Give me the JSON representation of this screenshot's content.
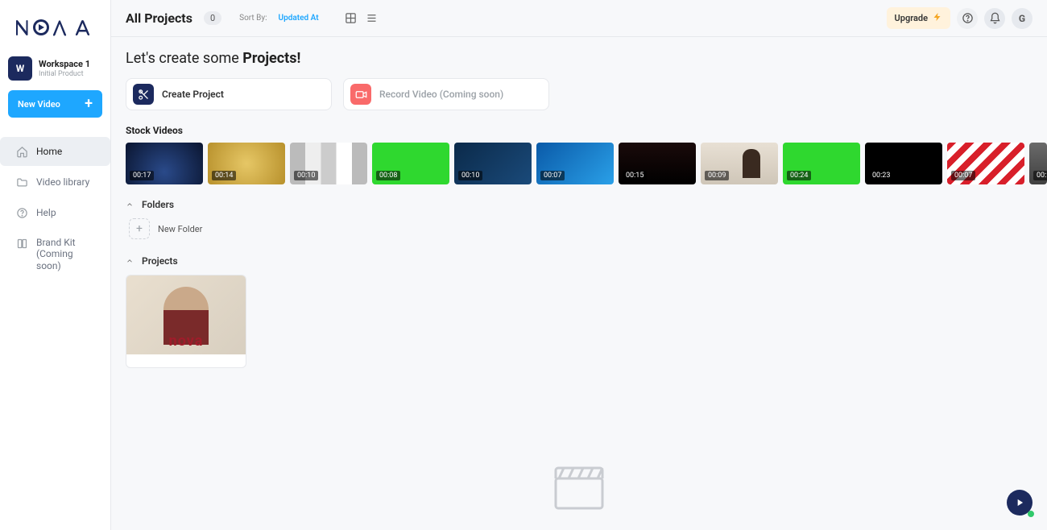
{
  "brand": "nova",
  "workspace": {
    "badge": "W",
    "name": "Workspace 1",
    "subtitle": "Initial Product"
  },
  "newVideo": "New Video",
  "nav": {
    "home": "Home",
    "library": "Video library",
    "help": "Help",
    "brandkit_line1": "Brand Kit",
    "brandkit_line2": "(Coming soon)"
  },
  "header": {
    "title": "All Projects",
    "count": "0",
    "sortLabel": "Sort By:",
    "sortValue": "Updated At",
    "upgrade": "Upgrade",
    "avatar": "G"
  },
  "headline": {
    "prefix": "Let's create some ",
    "bold": "Projects!"
  },
  "actions": {
    "create": "Create Project",
    "record": "Record Video (Coming soon)"
  },
  "stock": {
    "heading": "Stock Videos",
    "items": [
      {
        "dur": "00:17",
        "bg": "bg-city"
      },
      {
        "dur": "00:14",
        "bg": "bg-gold"
      },
      {
        "dur": "00:10",
        "bg": "bg-collage"
      },
      {
        "dur": "00:08",
        "bg": "bg-green"
      },
      {
        "dur": "00:10",
        "bg": "bg-chain"
      },
      {
        "dur": "00:07",
        "bg": "bg-water"
      },
      {
        "dur": "00:15",
        "bg": "bg-dark"
      },
      {
        "dur": "00:09",
        "bg": "bg-office"
      },
      {
        "dur": "00:24",
        "bg": "bg-green"
      },
      {
        "dur": "00:23",
        "bg": "bg-space"
      },
      {
        "dur": "00:07",
        "bg": "bg-stripe"
      },
      {
        "dur": "00:",
        "bg": "bg-grey",
        "partial": true
      }
    ]
  },
  "folders": {
    "heading": "Folders",
    "newFolder": "New Folder"
  },
  "projects": {
    "heading": "Projects",
    "watermark": "nova"
  }
}
